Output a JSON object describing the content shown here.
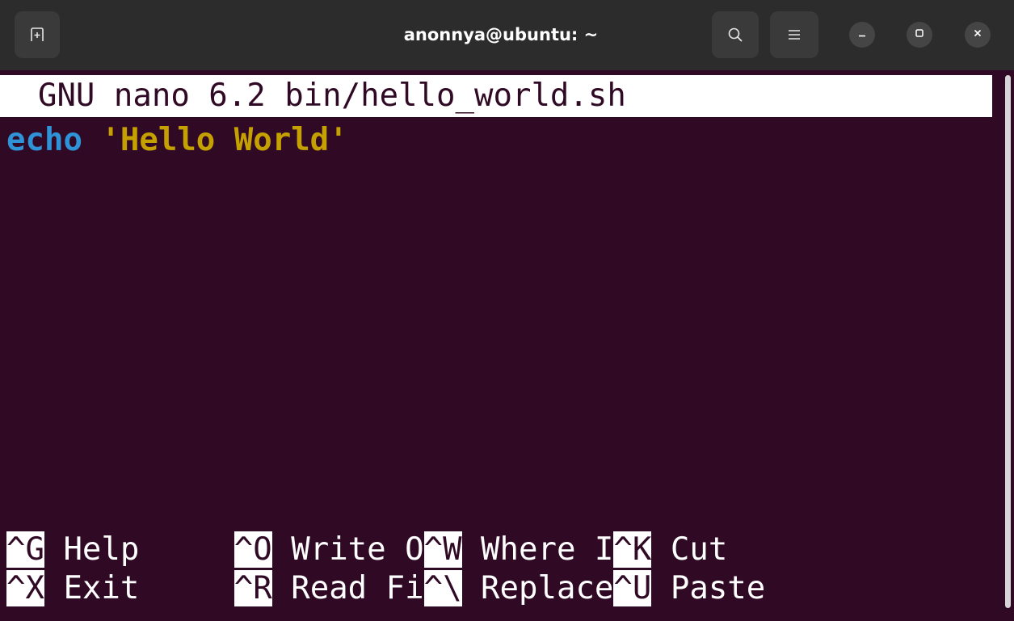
{
  "window": {
    "title": "anonnya@ubuntu: ~"
  },
  "icons": {
    "new_tab": "new-tab-icon",
    "search": "search-icon",
    "menu": "hamburger-menu-icon",
    "minimize": "minimize-icon",
    "maximize": "maximize-icon",
    "close": "close-icon"
  },
  "nano": {
    "header": "  GNU nano 6.2 bin/hello_world.sh",
    "line_keyword": "echo",
    "line_space": " ",
    "line_string": "'Hello World'",
    "shortcuts_row1": [
      {
        "key": "^G",
        "label": " Help     "
      },
      {
        "key": "^O",
        "label": " Write O"
      },
      {
        "key": "^W",
        "label": " Where I"
      },
      {
        "key": "^K",
        "label": " Cut"
      }
    ],
    "shortcuts_row2": [
      {
        "key": "^X",
        "label": " Exit     "
      },
      {
        "key": "^R",
        "label": " Read Fi"
      },
      {
        "key": "^\\",
        "label": " Replace"
      },
      {
        "key": "^U",
        "label": " Paste"
      }
    ]
  },
  "colors": {
    "terminal_bg": "#300a24",
    "keyword": "#2f93d7",
    "string": "#c4a000",
    "titlebar_bg": "#2c2c2c"
  }
}
